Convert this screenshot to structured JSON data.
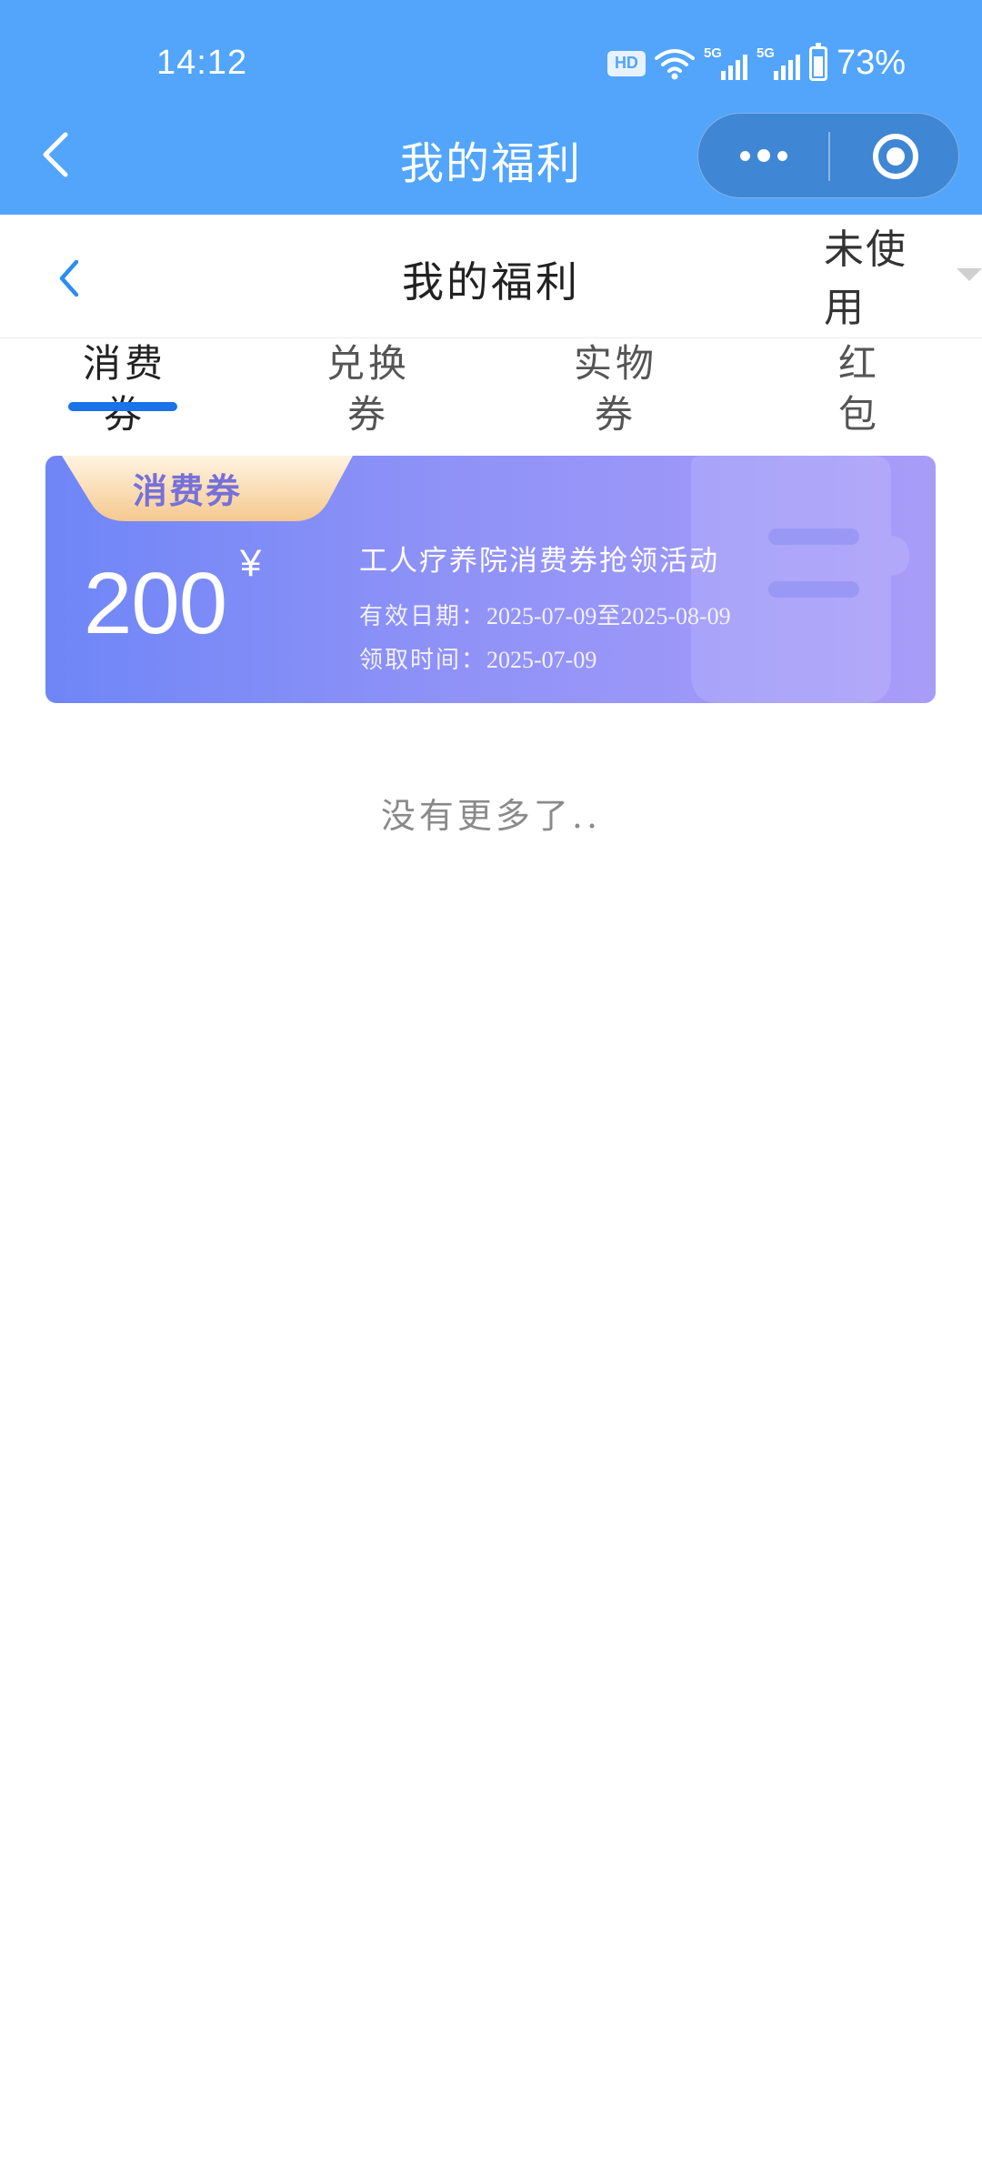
{
  "status_bar": {
    "time": "14:12",
    "hd_badge": "HD",
    "network_1": "5G",
    "network_2": "5G",
    "battery": "73%"
  },
  "mini_program_bar": {
    "title": "我的福利",
    "back_icon": "chevron-left-icon",
    "more_icon": "more-dots-icon",
    "close_icon": "target-circle-icon"
  },
  "header": {
    "title": "我的福利",
    "filter_value": "未使用",
    "back_icon": "chevron-left-icon"
  },
  "tabs": [
    {
      "label": "消费券",
      "active": true
    },
    {
      "label": "兑换券",
      "active": false
    },
    {
      "label": "实物券",
      "active": false
    },
    {
      "label": "红包",
      "active": false
    }
  ],
  "coupons": [
    {
      "tag": "消费券",
      "amount": "200",
      "currency": "¥",
      "name": "工人疗养院消费券抢领活动",
      "valid_label": "有效日期：",
      "valid_value": "2025-07-09至2025-08-09",
      "claim_label": "领取时间：",
      "claim_value": "2025-07-09"
    }
  ],
  "list_end_text": "没有更多了..",
  "colors": {
    "top_bar": "#52a5fb",
    "tab_indicator": "#1a73e8",
    "coupon_start": "#6f86f7",
    "coupon_end": "#a99cf9",
    "coupon_tag_text": "#7670d8"
  }
}
